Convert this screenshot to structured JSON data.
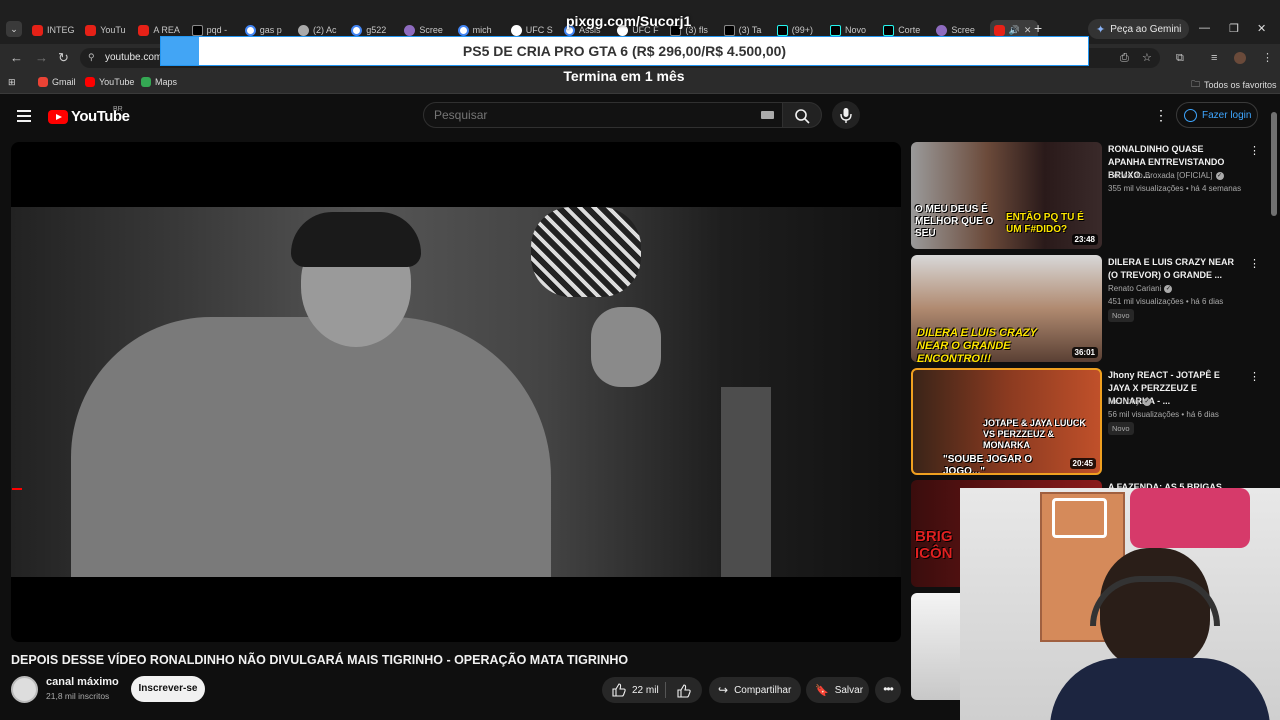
{
  "browser": {
    "tabs": [
      {
        "label": "INTEG",
        "icon": "youtube-icon"
      },
      {
        "label": "YouTu",
        "icon": "youtube-icon"
      },
      {
        "label": "A REA",
        "icon": "youtube-icon"
      },
      {
        "label": "pqd -",
        "icon": "x-icon"
      },
      {
        "label": "gas p",
        "icon": "google-icon"
      },
      {
        "label": "(2) Ac",
        "icon": "twitch-icon"
      },
      {
        "label": "g522",
        "icon": "google-icon"
      },
      {
        "label": "Scree",
        "icon": "pen-icon"
      },
      {
        "label": "mich",
        "icon": "google-icon"
      },
      {
        "label": "UFC S",
        "icon": "ufc-icon"
      },
      {
        "label": "Assis",
        "icon": "google-icon"
      },
      {
        "label": "UFC F",
        "icon": "ufc-icon"
      },
      {
        "label": "(3) fls",
        "icon": "x-icon"
      },
      {
        "label": "(3) Ta",
        "icon": "x-icon"
      },
      {
        "label": "(99+)",
        "icon": "tiktok-icon"
      },
      {
        "label": "Novo",
        "icon": "tiktok-icon"
      },
      {
        "label": "Corte",
        "icon": "tiktok-icon"
      },
      {
        "label": "Scree",
        "icon": "pen-icon"
      }
    ],
    "gemini_label": "Peça ao Gemini",
    "url": "youtube.com/",
    "bookmarks": [
      {
        "label": "Gmail",
        "color": "#ea4335"
      },
      {
        "label": "YouTube",
        "color": "#ff0000"
      },
      {
        "label": "Maps",
        "color": "#34a853"
      }
    ],
    "bookmarks_folder": "Todos os favoritos"
  },
  "stream_overlay": {
    "top_text": "pixgg.com/Sucorj1",
    "goal_text": "PS5 DE CRIA PRO GTA 6 (R$ 296,00/R$ 4.500,00)",
    "goal_progress": 0.066,
    "sub_text": "Termina em 1 mês"
  },
  "youtube": {
    "logo_text": "YouTube",
    "region": "BR",
    "search_placeholder": "Pesquisar",
    "login_label": "Fazer login",
    "video": {
      "title": "DEPOIS DESSE VÍDEO RONALDINHO NÃO DIVULGARÁ MAIS TIGRINHO - OPERAÇÃO MATA TIGRINHO",
      "channel": "canal máximo",
      "subscribers": "21,8 mil inscritos",
      "subscribe_label": "Inscrever-se",
      "likes": "22 mil",
      "share_label": "Compartilhar",
      "save_label": "Salvar"
    },
    "recommendations": [
      {
        "title": "RONALDINHO QUASE APANHA ENTREVISTANDO BRUXO ...",
        "channel": "Cortes do Broxada [OFICIAL]",
        "meta": "355 mil visualizações • há 4 semanas",
        "duration": "23:48",
        "badge": "",
        "thumb_text_left": "O MEU DEUS É MELHOR QUE O SEU",
        "thumb_text_right": "ENTÃO PQ TU É UM F#DIDO?"
      },
      {
        "title": "DILERA E LUIS CRAZY NEAR (O TREVOR) O GRANDE ...",
        "channel": "Renato Cariani",
        "meta": "451 mil visualizações • há 6 dias",
        "duration": "36:01",
        "badge": "Novo",
        "thumb_text_left": "DILERA E LUIS CRAZY NEAR O GRANDE ENCONTRO!!!",
        "thumb_text_right": ""
      },
      {
        "title": "Jhony REACT - JOTAPÊ E JAYA X PERZZEUZ E MONARKA - ...",
        "channel": "McJhony",
        "meta": "56 mil visualizações • há 6 dias",
        "duration": "20:45",
        "badge": "Novo",
        "thumb_text_left": "\"SOUBE JOGAR O JOGO...\"",
        "thumb_text_right": "JOTAPE & JAYA LUUCK VS PERZZEUZ & MONARKA"
      },
      {
        "title": "A FAZENDA: AS 5 BRIGAS QUE",
        "channel": "",
        "meta": "",
        "duration": "",
        "badge": "",
        "thumb_text_left": "BRIG ICÔN",
        "thumb_text_right": ""
      }
    ]
  }
}
